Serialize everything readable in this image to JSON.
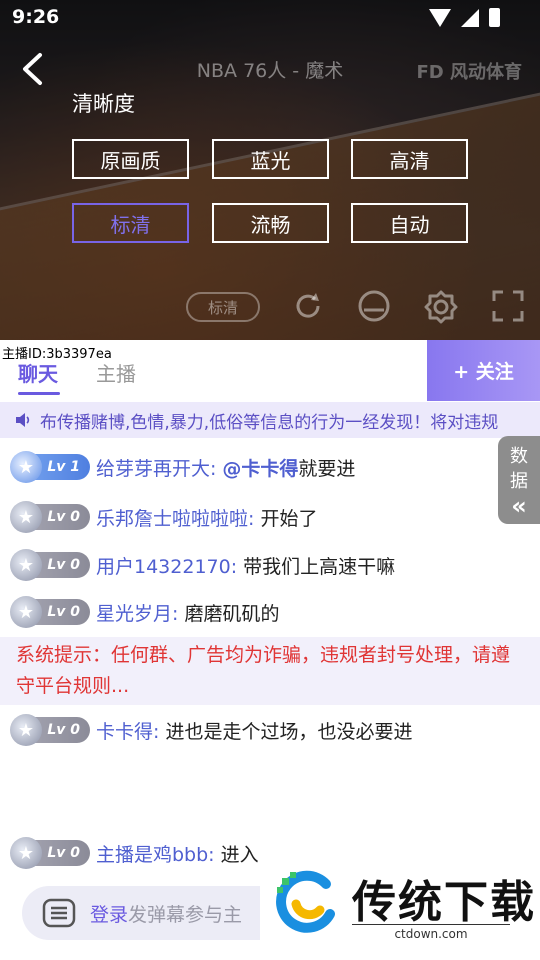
{
  "status_bar": {
    "time": "9:26"
  },
  "video": {
    "title": "NBA 76人 - 魔术",
    "watermark": "FD 风动体育",
    "clarity_label": "清晰度",
    "quality_options": [
      {
        "label": "原画质",
        "selected": false
      },
      {
        "label": "蓝光",
        "selected": false
      },
      {
        "label": "高清",
        "selected": false
      },
      {
        "label": "标清",
        "selected": true
      },
      {
        "label": "流畅",
        "selected": false
      },
      {
        "label": "自动",
        "selected": false
      }
    ],
    "current_quality": "标清"
  },
  "anchor_id": "主播ID:3b3397ea",
  "tabs": [
    {
      "label": "聊天",
      "active": true
    },
    {
      "label": "主播",
      "active": false
    }
  ],
  "follow_button": "+ 关注",
  "notice": "布传播赌博,色情,暴力,低俗等信息的行为一经发现！将对违规",
  "data_tab": [
    "数",
    "据",
    "«"
  ],
  "messages": [
    {
      "level": "Lv 1",
      "user": "给芽芽再开大:",
      "mention": "@卡卡得",
      "text": "就要进"
    },
    {
      "level": "Lv 0",
      "user": "乐邦詹士啦啦啦啦:",
      "text": " 开始了"
    },
    {
      "level": "Lv 0",
      "user": "用户14322170:",
      "text": " 带我们上高速干嘛"
    },
    {
      "level": "Lv 0",
      "user": "星光岁月:",
      "text": " 磨磨矶矶的"
    },
    {
      "level": "Lv 0",
      "user": "卡卡得:",
      "text": " 进也是走个过场，也没必要进"
    },
    {
      "level": "Lv 0",
      "user": "主播是鸡bbb:",
      "text": " 进入"
    }
  ],
  "system_notice": "系统提示：任何群、广告均为诈骗，违规者封号处理，请遵守平台规则...",
  "input": {
    "login": "登录",
    "placeholder": "发弹幕参与主"
  },
  "watermark_logo": {
    "name": "传统下载",
    "url": "ctdown.com"
  },
  "colors": {
    "accent": "#6a5ae0",
    "system_red": "#e03535",
    "notice_bg": "#ece9fb"
  }
}
